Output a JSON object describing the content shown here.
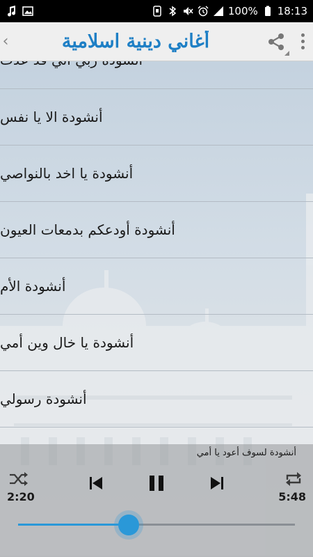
{
  "status_bar": {
    "battery_percent": "100%",
    "time": "18:13"
  },
  "app_bar": {
    "title": "أغاني دينية اسلامية"
  },
  "list": {
    "items": [
      "أنشودة ربي اني قد عدت",
      "أنشودة الا يا نفس",
      "أنشودة يا اخد بالنواصي",
      "أنشودة أودعكم بدمعات العيون",
      "أنشودة الأم",
      "أنشودة يا خال وين أمي",
      "أنشودة رسولي"
    ]
  },
  "player": {
    "now_playing": "أنشودة لسوف أعود يا أمي",
    "elapsed": "2:20",
    "duration": "5:48",
    "progress": 0.4,
    "accent_color": "#2a98d8"
  },
  "icons": {
    "status_left": [
      "music-note-icon",
      "image-icon"
    ],
    "status_right": [
      "nfc-icon",
      "bluetooth-icon",
      "mute-icon",
      "alarm-icon",
      "signal-icon",
      "battery-icon"
    ],
    "app_bar": [
      "chevron-left-icon",
      "share-icon",
      "more-vert-icon"
    ],
    "player": [
      "shuffle-icon",
      "previous-icon",
      "pause-icon",
      "next-icon",
      "repeat-icon"
    ]
  }
}
